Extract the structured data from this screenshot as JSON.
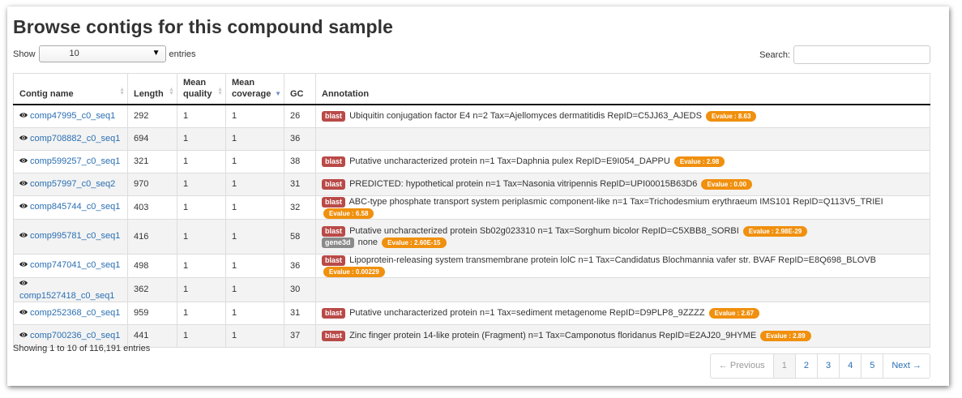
{
  "page": {
    "title": "Browse contigs for this compound sample"
  },
  "length_control": {
    "prefix": "Show",
    "value": "10",
    "suffix": "entries"
  },
  "search": {
    "label": "Search:",
    "value": ""
  },
  "columns": [
    {
      "line1": "Contig name",
      "line2": ""
    },
    {
      "line1": "Length",
      "line2": ""
    },
    {
      "line1": "Mean",
      "line2": "quality"
    },
    {
      "line1": "Mean",
      "line2": "coverage"
    },
    {
      "line1": "GC",
      "line2": ""
    },
    {
      "line1": "Annotation",
      "line2": ""
    }
  ],
  "rows": [
    {
      "name": "comp47995_c0_seq1",
      "length": "292",
      "quality": "1",
      "coverage": "1",
      "gc": "26",
      "annotations": [
        {
          "tag": "blast",
          "text": "Ubiquitin conjugation factor E4 n=2 Tax=Ajellomyces dermatitidis RepID=C5JJ63_AJEDS",
          "evalue": "Evalue : 8.63"
        }
      ]
    },
    {
      "name": "comp708882_c0_seq1",
      "length": "694",
      "quality": "1",
      "coverage": "1",
      "gc": "36",
      "annotations": []
    },
    {
      "name": "comp599257_c0_seq1",
      "length": "321",
      "quality": "1",
      "coverage": "1",
      "gc": "38",
      "annotations": [
        {
          "tag": "blast",
          "text": "Putative uncharacterized protein n=1 Tax=Daphnia pulex RepID=E9I054_DAPPU",
          "evalue": "Evalue : 2.98"
        }
      ]
    },
    {
      "name": "comp57997_c0_seq2",
      "length": "970",
      "quality": "1",
      "coverage": "1",
      "gc": "31",
      "annotations": [
        {
          "tag": "blast",
          "text": "PREDICTED: hypothetical protein n=1 Tax=Nasonia vitripennis RepID=UPI00015B63D6",
          "evalue": "Evalue : 0.00"
        }
      ]
    },
    {
      "name": "comp845744_c0_seq1",
      "length": "403",
      "quality": "1",
      "coverage": "1",
      "gc": "32",
      "annotations": [
        {
          "tag": "blast",
          "text": "ABC-type phosphate transport system periplasmic component-like n=1 Tax=Trichodesmium erythraeum IMS101 RepID=Q113V5_TRIEI",
          "evalue": "Evalue : 6.58"
        }
      ]
    },
    {
      "name": "comp995781_c0_seq1",
      "length": "416",
      "quality": "1",
      "coverage": "1",
      "gc": "58",
      "annotations": [
        {
          "tag": "blast",
          "text": "Putative uncharacterized protein Sb02g023310 n=1 Tax=Sorghum bicolor RepID=C5XBB8_SORBI",
          "evalue": "Evalue : 2.98E-29"
        },
        {
          "tag": "gene3d",
          "text": "none",
          "evalue": "Evalue : 2.60E-15"
        }
      ]
    },
    {
      "name": "comp747041_c0_seq1",
      "length": "498",
      "quality": "1",
      "coverage": "1",
      "gc": "36",
      "annotations": [
        {
          "tag": "blast",
          "text": "Lipoprotein-releasing system transmembrane protein lolC n=1 Tax=Candidatus Blochmannia vafer str. BVAF RepID=E8Q698_BLOVB",
          "evalue": "Evalue : 0.00229"
        }
      ]
    },
    {
      "name": "comp1527418_c0_seq1",
      "length": "362",
      "quality": "1",
      "coverage": "1",
      "gc": "30",
      "annotations": []
    },
    {
      "name": "comp252368_c0_seq1",
      "length": "959",
      "quality": "1",
      "coverage": "1",
      "gc": "31",
      "annotations": [
        {
          "tag": "blast",
          "text": "Putative uncharacterized protein n=1 Tax=sediment metagenome RepID=D9PLP8_9ZZZZ",
          "evalue": "Evalue : 2.67"
        }
      ]
    },
    {
      "name": "comp700236_c0_seq1",
      "length": "441",
      "quality": "1",
      "coverage": "1",
      "gc": "37",
      "annotations": [
        {
          "tag": "blast",
          "text": "Zinc finger protein 14-like protein (Fragment) n=1 Tax=Camponotus floridanus RepID=E2AJ20_9HYME",
          "evalue": "Evalue : 2.89"
        }
      ]
    }
  ],
  "info": "Showing 1 to 10 of 116,191 entries",
  "pagination": {
    "previous": "← Previous",
    "pages": [
      "1",
      "2",
      "3",
      "4",
      "5"
    ],
    "current": "1",
    "next": "Next →"
  },
  "icons": {
    "view": "eye-icon",
    "sort": "sort-arrows-icon",
    "dropdown": "caret-down-icon"
  },
  "colors": {
    "link": "#2a6fb3",
    "blast_label": "#b94a48",
    "gene3d_label": "#8a8a8a",
    "evalue_badge": "#f0900e"
  }
}
